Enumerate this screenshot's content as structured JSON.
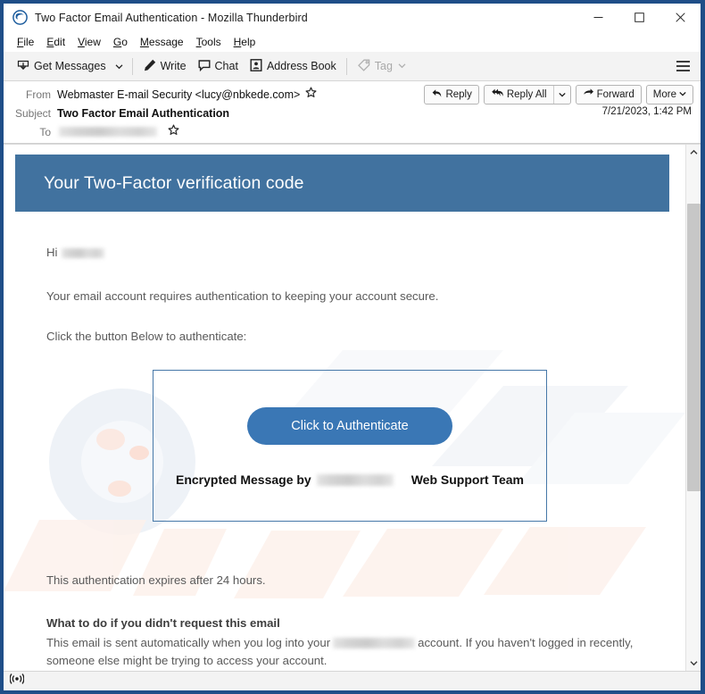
{
  "window": {
    "title": "Two Factor Email Authentication - Mozilla Thunderbird",
    "app_icon": "thunderbird-icon",
    "controls": {
      "minimize": "minimize-icon",
      "maximize": "maximize-icon",
      "close": "close-icon"
    },
    "frame_color": "#1f4e88"
  },
  "menu": {
    "items": [
      {
        "label": "File",
        "access": "F"
      },
      {
        "label": "Edit",
        "access": "E"
      },
      {
        "label": "View",
        "access": "V"
      },
      {
        "label": "Go",
        "access": "G"
      },
      {
        "label": "Message",
        "access": "M"
      },
      {
        "label": "Tools",
        "access": "T"
      },
      {
        "label": "Help",
        "access": "H"
      }
    ]
  },
  "toolbar": {
    "get_messages": "Get Messages",
    "write": "Write",
    "chat": "Chat",
    "address_book": "Address Book",
    "tag": "Tag",
    "tag_disabled": true,
    "hamburger": "app-menu-icon"
  },
  "message_header": {
    "from_label": "From",
    "from_value": "Webmaster E-mail Security <lucy@nbkede.com>",
    "subject_label": "Subject",
    "subject_value": "Two Factor Email Authentication",
    "to_label": "To",
    "to_value_redacted": true,
    "date": "7/21/2023, 1:42 PM",
    "actions": {
      "reply": "Reply",
      "reply_all": "Reply All",
      "forward": "Forward",
      "more": "More"
    }
  },
  "email": {
    "banner_title": "Your Two-Factor verification code",
    "banner_color": "#41729f",
    "greeting_prefix": "Hi",
    "greeting_redacted": true,
    "line_1": "Your email account requires authentication to keeping your account secure.",
    "line_2": "Click the button Below to authenticate:",
    "auth_button_label": "Click to Authenticate",
    "auth_button_color": "#3a77b5",
    "card_border_color": "#4678a8",
    "encrypted_prefix": "Encrypted Message by",
    "encrypted_redacted": true,
    "encrypted_suffix": "Web Support Team",
    "expiry_line": "This authentication expires after 24 hours.",
    "whatdo_heading": "What to do if you didn't request this email",
    "whatdo_text_before": "This email is sent automatically when you log into your",
    "whatdo_text_after": "account. If you haven't logged in recently, someone else might be trying to access your account.",
    "whatdo_redacted": true
  },
  "scrollbar": {
    "up_arrow": "chevron-up-icon",
    "down_arrow": "chevron-down-icon",
    "thumb": "scrollbar-thumb"
  },
  "status_bar": {
    "icon": "broadcast-icon"
  }
}
